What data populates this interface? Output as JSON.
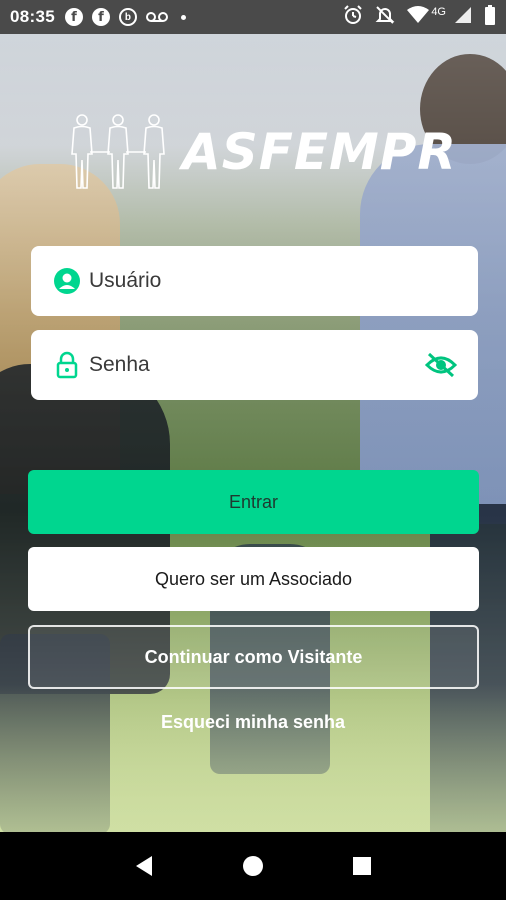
{
  "status_bar": {
    "time": "08:35",
    "left_icons": [
      "facebook-icon",
      "facebook-icon",
      "circle-b-icon",
      "voicemail-icon",
      "dot-icon"
    ],
    "right_icons": [
      "alarm-icon",
      "mute-icon",
      "wifi-icon",
      "signal-icon",
      "battery-icon"
    ],
    "network": "4G"
  },
  "logo": {
    "text": "ASFEMPR"
  },
  "login": {
    "username_placeholder": "Usuário",
    "password_placeholder": "Senha"
  },
  "buttons": {
    "enter": "Entrar",
    "become_member": "Quero ser um Associado",
    "visitor": "Continuar como Visitante",
    "forgot_password": "Esqueci minha senha"
  },
  "colors": {
    "accent": "#00d68f",
    "status_bar": "#4a4a4a",
    "nav_bar": "#000000"
  }
}
